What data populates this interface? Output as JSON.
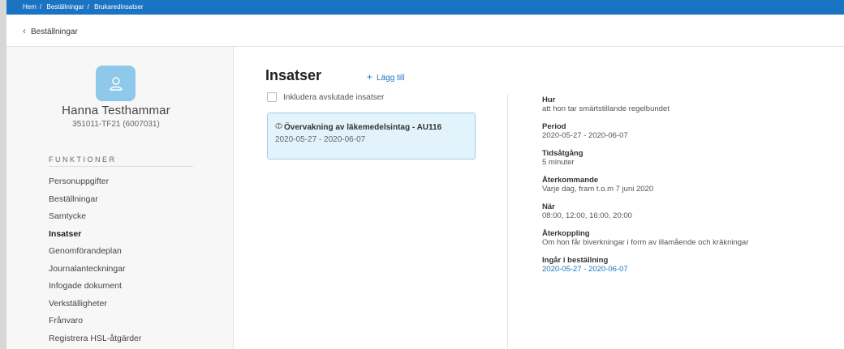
{
  "breadcrumb": [
    "Hem",
    "Beställningar",
    "Brukaredinsatser"
  ],
  "back_link": "Beställningar",
  "user": {
    "name": "Hanna Testhammar",
    "id": "351011-TF21 (6007031)"
  },
  "sidebar": {
    "heading": "FUNKTIONER",
    "items": [
      {
        "label": "Personuppgifter"
      },
      {
        "label": "Beställningar"
      },
      {
        "label": "Samtycke"
      },
      {
        "label": "Insatser",
        "active": true
      },
      {
        "label": "Genomförandeplan"
      },
      {
        "label": "Journalanteckningar"
      },
      {
        "label": "Infogade dokument"
      },
      {
        "label": "Verkställigheter"
      },
      {
        "label": "Frånvaro"
      },
      {
        "label": "Registrera HSL-åtgärder"
      }
    ]
  },
  "main": {
    "title": "Insatser",
    "add_label": "Lägg till",
    "include_finished_label": "Inkludera avslutade insatser",
    "card": {
      "title": "Övervakning av läkemedelsintag - AU116",
      "dates": "2020-05-27 - 2020-06-07"
    }
  },
  "details": [
    {
      "label": "Hur",
      "value": "att hon tar smärtstillande regelbundet"
    },
    {
      "label": "Period",
      "value": "2020-05-27 - 2020-06-07"
    },
    {
      "label": "Tidsåtgång",
      "value": "5 minuter"
    },
    {
      "label": "Återkommande",
      "value": "Varje dag, fram t.o.m 7 juni 2020"
    },
    {
      "label": "När",
      "value": "08:00, 12:00, 16:00, 20:00"
    },
    {
      "label": "Återkoppling",
      "value": "Om hon får biverkningar i form av illamående och kräkningar"
    },
    {
      "label": "Ingår i beställning",
      "value": "2020-05-27 - 2020-06-07"
    }
  ],
  "colors": {
    "primary": "#1b74c3",
    "card_bg": "#e3f3fc",
    "card_border": "#9ccfea",
    "avatar": "#8ec8ea"
  }
}
